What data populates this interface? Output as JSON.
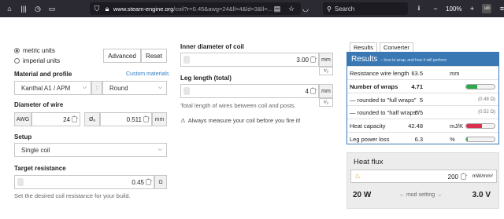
{
  "browser": {
    "url_domain": "www.steam-engine.org",
    "url_rest": "/coil?r=0.45&awg=24&ll=4&ld=3&ll=...",
    "search_placeholder": "Search",
    "zoom": "100%"
  },
  "units": {
    "metric_label": "metric units",
    "imperial_label": "imperial units",
    "selected": "metric"
  },
  "buttons": {
    "advanced": "Advanced",
    "reset": "Reset"
  },
  "material": {
    "label": "Material and profile",
    "custom_link": "Custom materials",
    "material_value": "Kanthal A1 / APM",
    "separator": ":",
    "profile_value": "Round"
  },
  "wire": {
    "label": "Diameter of wire",
    "awg_addon": "AWG",
    "awg_value": "24",
    "diam_addon": "Øₐ",
    "diam_value": "0.511",
    "unit": "mm"
  },
  "setup": {
    "label": "Setup",
    "value": "Single coil"
  },
  "target": {
    "label": "Target resistance",
    "value": "0.45",
    "unit": "Ω",
    "help": "Set the desired coil resistance for your build."
  },
  "inner": {
    "label": "Inner diameter of coil",
    "value": "3.00",
    "unit": "mm",
    "sub_unit": "⁵⁄₃"
  },
  "legs": {
    "label": "Leg length (total)",
    "value": "4",
    "unit": "mm",
    "sub_unit": "⁵⁄₃",
    "help": "Total length of wires between coil and posts.",
    "warning": "Always measure your coil before you fire it!"
  },
  "tabs": {
    "results": "Results",
    "converter": "Converter"
  },
  "results": {
    "title": "Results",
    "subtitle": "– how to wrap, and how it will perform",
    "rows": [
      {
        "label": "Resistance wire length",
        "value": "63.5",
        "unit": "mm",
        "note": ""
      },
      {
        "label": "Number of wraps",
        "value": "4.71",
        "unit": "",
        "note": "",
        "bold": true,
        "bar": 0.4,
        "bar_color": "#2ea84a"
      },
      {
        "label": "— rounded to \"full wraps\"",
        "value": "5",
        "unit": "",
        "note": "(0.48 Ω)"
      },
      {
        "label": "— rounded to \"half wraps\"",
        "value": "6/5",
        "unit": "",
        "note": "(0.52 Ω)"
      },
      {
        "label": "Heat capacity",
        "value": "42.48",
        "unit": "mJ/K",
        "note": "",
        "bar": 0.55,
        "bar_color": "#d9304f"
      },
      {
        "label": "Leg power loss",
        "value": "6.3",
        "unit": "%",
        "note": "",
        "bar": 0.05,
        "bar_color": "#2ea84a"
      }
    ]
  },
  "heat": {
    "title": "Heat flux",
    "value": "200",
    "unit": "mW/mm²",
    "watts": "20 W",
    "mode": "← mod setting →",
    "volts": "3.0 V"
  }
}
